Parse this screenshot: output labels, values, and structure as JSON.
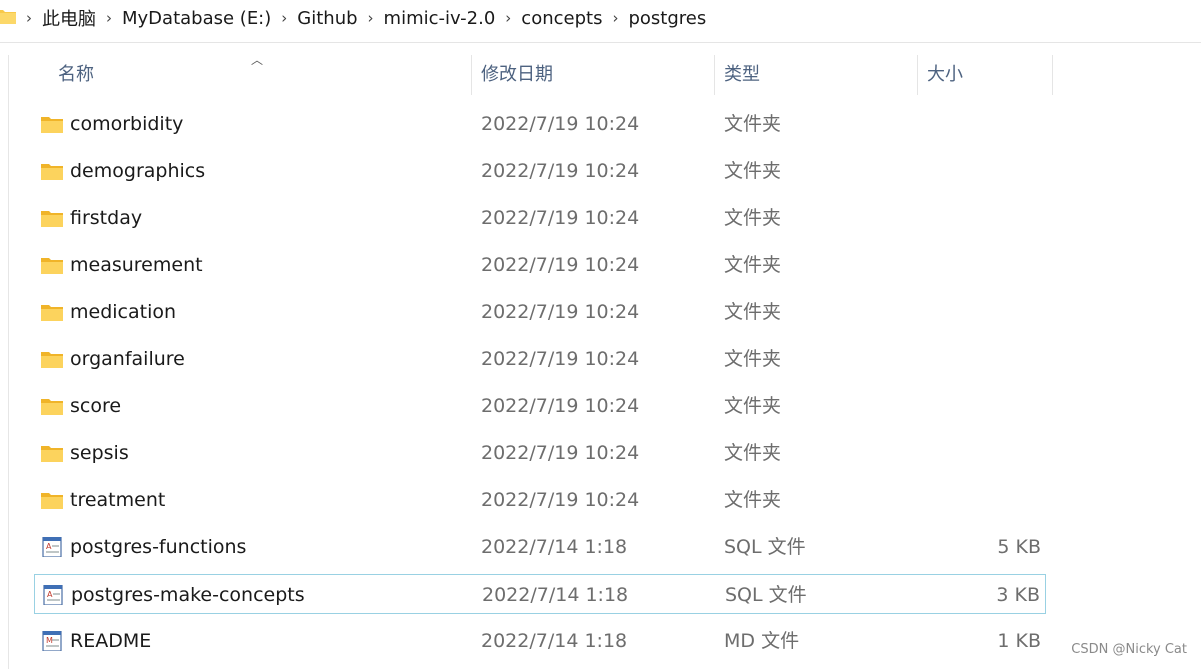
{
  "breadcrumb": [
    "此电脑",
    "MyDatabase (E:)",
    "Github",
    "mimic-iv-2.0",
    "concepts",
    "postgres"
  ],
  "columns": {
    "name": "名称",
    "date": "修改日期",
    "type": "类型",
    "size": "大小"
  },
  "files": [
    {
      "name": "comorbidity",
      "date": "2022/7/19 10:24",
      "type": "文件夹",
      "size": "",
      "icon": "folder-icon"
    },
    {
      "name": "demographics",
      "date": "2022/7/19 10:24",
      "type": "文件夹",
      "size": "",
      "icon": "folder-icon"
    },
    {
      "name": "firstday",
      "date": "2022/7/19 10:24",
      "type": "文件夹",
      "size": "",
      "icon": "folder-icon"
    },
    {
      "name": "measurement",
      "date": "2022/7/19 10:24",
      "type": "文件夹",
      "size": "",
      "icon": "folder-icon"
    },
    {
      "name": "medication",
      "date": "2022/7/19 10:24",
      "type": "文件夹",
      "size": "",
      "icon": "folder-icon"
    },
    {
      "name": "organfailure",
      "date": "2022/7/19 10:24",
      "type": "文件夹",
      "size": "",
      "icon": "folder-icon"
    },
    {
      "name": "score",
      "date": "2022/7/19 10:24",
      "type": "文件夹",
      "size": "",
      "icon": "folder-icon"
    },
    {
      "name": "sepsis",
      "date": "2022/7/19 10:24",
      "type": "文件夹",
      "size": "",
      "icon": "folder-icon"
    },
    {
      "name": "treatment",
      "date": "2022/7/19 10:24",
      "type": "文件夹",
      "size": "",
      "icon": "folder-icon"
    },
    {
      "name": "postgres-functions",
      "date": "2022/7/14 1:18",
      "type": "SQL 文件",
      "size": "5 KB",
      "icon": "sql-file-icon"
    },
    {
      "name": "postgres-make-concepts",
      "date": "2022/7/14 1:18",
      "type": "SQL 文件",
      "size": "3 KB",
      "icon": "sql-file-icon",
      "selected": true
    },
    {
      "name": "README",
      "date": "2022/7/14 1:18",
      "type": "MD 文件",
      "size": "1 KB",
      "icon": "md-file-icon"
    }
  ],
  "watermark": "CSDN @Nicky Cat",
  "colors": {
    "folder": "#f8c94a",
    "selection_border": "#99d1e3",
    "header_text": "#4d6280"
  }
}
